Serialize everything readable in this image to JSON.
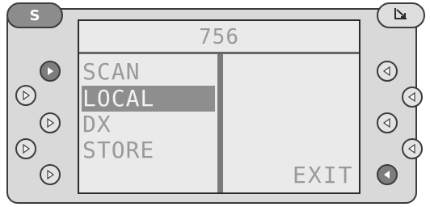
{
  "header": {
    "left_button": "S",
    "right_button_icon": "corner-arrow-icon"
  },
  "screen": {
    "title": "756",
    "menu": [
      {
        "label": "SCAN",
        "selected": false
      },
      {
        "label": "LOCAL",
        "selected": true
      },
      {
        "label": "DX",
        "selected": false
      },
      {
        "label": "STORE",
        "selected": false
      }
    ],
    "exit_label": "EXIT"
  },
  "colors": {
    "selection": "#8e8e8e",
    "screen_bg": "#eaeaea",
    "text": "#9a9a9a"
  }
}
